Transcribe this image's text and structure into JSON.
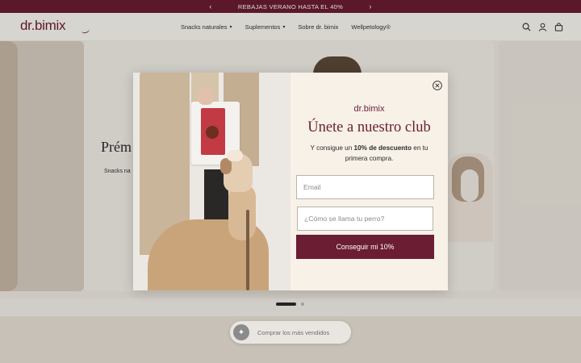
{
  "announcement": {
    "text": "REBAJAS VERANO HASTA EL 40%",
    "prev_icon": "‹",
    "next_icon": "›"
  },
  "header": {
    "logo": "dr.bimix",
    "nav": [
      {
        "label": "Snacks naturales",
        "has_dropdown": true
      },
      {
        "label": "Suplementos",
        "has_dropdown": true
      },
      {
        "label": "Sobre dr. bimix",
        "has_dropdown": false
      },
      {
        "label": "Wellpetology®",
        "has_dropdown": false
      }
    ],
    "icons": [
      "search-icon",
      "account-icon",
      "cart-icon"
    ]
  },
  "hero": {
    "title": "Prém",
    "subtitle": "Snacks na"
  },
  "carousel": {
    "slides": 2,
    "active": 1
  },
  "popup": {
    "logo": "dr.bimix",
    "title": "Únete a nuestro club",
    "subtitle_pre": "Y consigue un ",
    "subtitle_bold": "10% de descuento",
    "subtitle_post": " en tu primera compra.",
    "email_placeholder": "Email",
    "dogname_placeholder": "¿Cómo se llama tu perro?",
    "submit_label": "Conseguir mi 10%"
  },
  "floating": {
    "label": "Comprar los más vendidos",
    "icon": "sparkle-icon"
  },
  "colors": {
    "brand": "#6b1d33",
    "announcement_bg": "#6b1d33",
    "popup_bg": "#f7f1e8"
  }
}
